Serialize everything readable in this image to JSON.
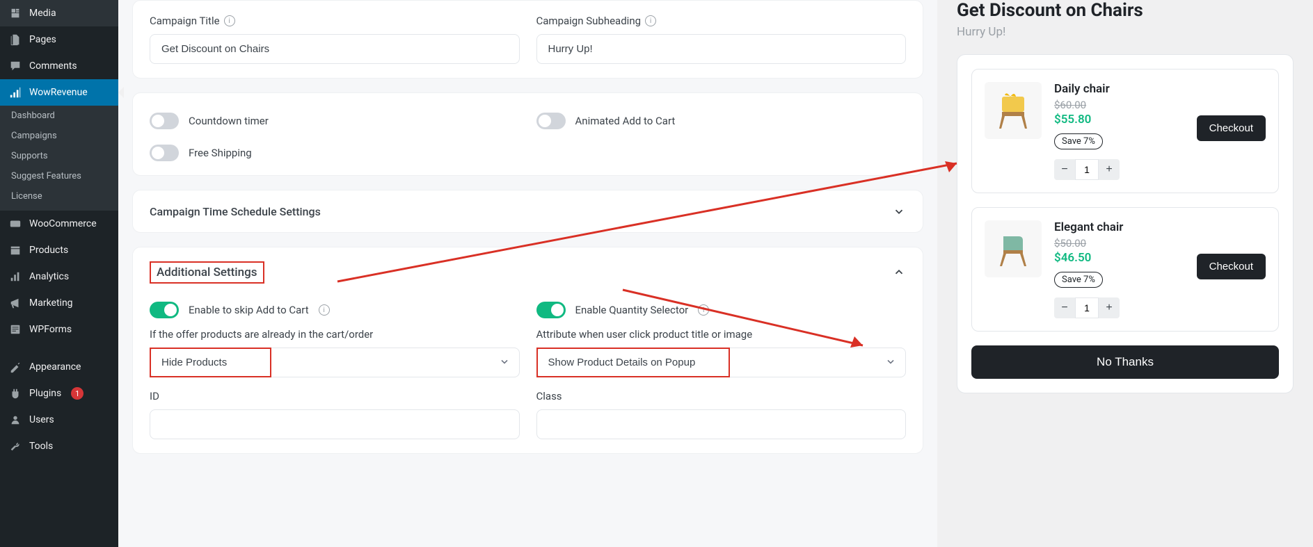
{
  "sidebar": {
    "top": [
      {
        "icon": "media",
        "label": "Media"
      },
      {
        "icon": "pages",
        "label": "Pages"
      },
      {
        "icon": "comments",
        "label": "Comments"
      }
    ],
    "active": {
      "icon": "wowrevenue",
      "label": "WowRevenue"
    },
    "sub": [
      "Dashboard",
      "Campaigns",
      "Supports",
      "Suggest Features",
      "License"
    ],
    "bottom": [
      {
        "icon": "woo",
        "label": "WooCommerce"
      },
      {
        "icon": "products",
        "label": "Products"
      },
      {
        "icon": "analytics",
        "label": "Analytics"
      },
      {
        "icon": "marketing",
        "label": "Marketing"
      },
      {
        "icon": "wpforms",
        "label": "WPForms"
      },
      {
        "icon": "appearance",
        "label": "Appearance"
      },
      {
        "icon": "plugins",
        "label": "Plugins",
        "badge": "1"
      },
      {
        "icon": "users",
        "label": "Users"
      },
      {
        "icon": "tools",
        "label": "Tools"
      }
    ]
  },
  "main": {
    "title_label": "Campaign Title",
    "title_value": "Get Discount on Chairs",
    "sub_label": "Campaign Subheading",
    "sub_value": "Hurry Up!",
    "toggles": {
      "countdown": "Countdown timer",
      "animated": "Animated Add to Cart",
      "freeship": "Free Shipping"
    },
    "schedule": "Campaign Time Schedule Settings",
    "additional": "Additional Settings",
    "skip_label": "Enable to skip Add to Cart",
    "qty_label": "Enable Quantity Selector",
    "cart_question": "If the offer products are already in the cart/order",
    "attr_question": "Attribute when user click product title or image",
    "hide_products": "Hide Products",
    "show_popup": "Show Product Details on Popup",
    "id_label": "ID",
    "class_label": "Class"
  },
  "preview": {
    "title": "Get Discount on Chairs",
    "sub": "Hurry Up!",
    "products": [
      {
        "name": "Daily chair",
        "old": "$60.00",
        "new": "$55.80",
        "save": "Save 7%",
        "qty": "1"
      },
      {
        "name": "Elegant chair",
        "old": "$50.00",
        "new": "$46.50",
        "save": "Save 7%",
        "qty": "1"
      }
    ],
    "checkout": "Checkout",
    "nothanks": "No Thanks"
  }
}
